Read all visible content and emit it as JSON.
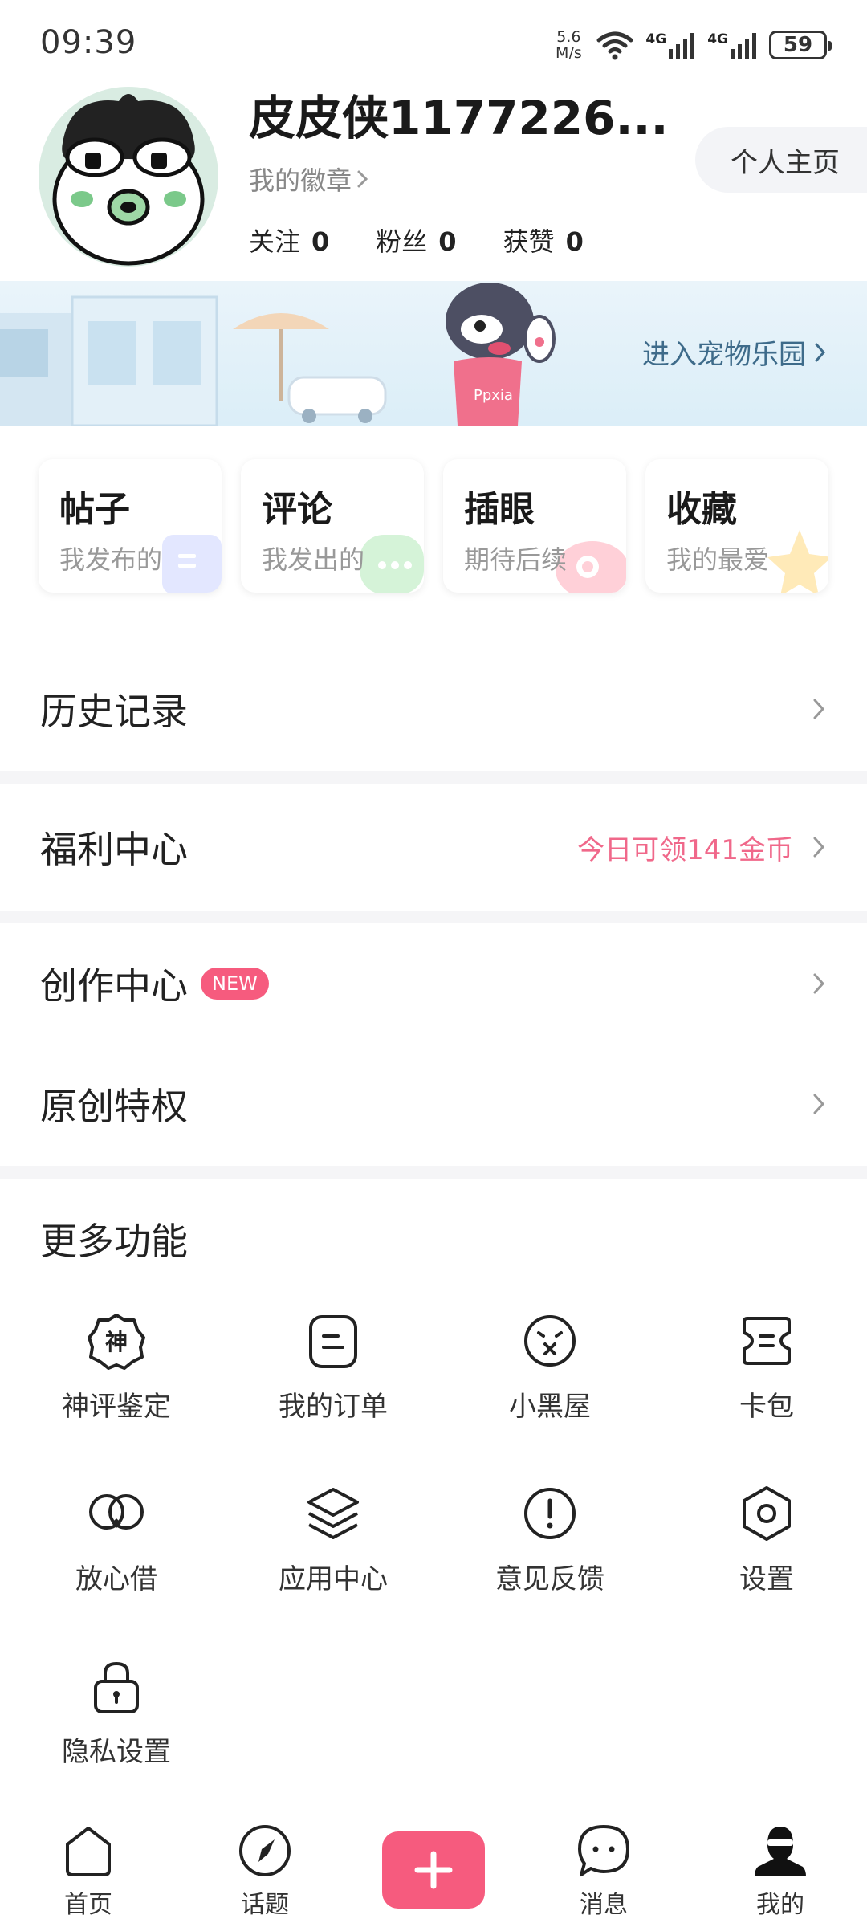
{
  "status_bar": {
    "time": "09:39",
    "speed_value": "5.6",
    "speed_unit": "M/s",
    "network_1": "4G",
    "network_2": "4G",
    "battery": "59"
  },
  "profile": {
    "username": "皮皮侠1177226...",
    "badge_label": "我的徽章",
    "stats": [
      {
        "label": "关注",
        "value": "0"
      },
      {
        "label": "粉丝",
        "value": "0"
      },
      {
        "label": "获赞",
        "value": "0"
      }
    ],
    "homepage_button": "个人主页"
  },
  "banner": {
    "text": "进入宠物乐园",
    "mascot_shirt_text": "Ppxia"
  },
  "cards": [
    {
      "title": "帖子",
      "subtitle": "我发布的",
      "color": "#dfe4ff"
    },
    {
      "title": "评论",
      "subtitle": "我发出的",
      "color": "#d9f5dc"
    },
    {
      "title": "插眼",
      "subtitle": "期待后续",
      "color": "#ffd6dc"
    },
    {
      "title": "收藏",
      "subtitle": "我的最爱",
      "color": "#ffedc2"
    }
  ],
  "menu": {
    "history": "历史记录",
    "welfare": "福利中心",
    "welfare_note": "今日可领141金币",
    "creation": "创作中心",
    "creation_tag": "NEW",
    "original": "原创特权"
  },
  "more": {
    "title": "更多功能",
    "items": [
      {
        "label": "神评鉴定",
        "icon": "shen-badge-icon",
        "glyph": "神"
      },
      {
        "label": "我的订单",
        "icon": "order-icon"
      },
      {
        "label": "小黑屋",
        "icon": "sad-face-icon"
      },
      {
        "label": "卡包",
        "icon": "card-wallet-icon"
      },
      {
        "label": "放心借",
        "icon": "loan-icon"
      },
      {
        "label": "应用中心",
        "icon": "layers-icon"
      },
      {
        "label": "意见反馈",
        "icon": "feedback-icon"
      },
      {
        "label": "设置",
        "icon": "settings-icon"
      },
      {
        "label": "隐私设置",
        "icon": "lock-icon"
      }
    ]
  },
  "bottom_nav": [
    {
      "label": "首页",
      "icon": "home-icon"
    },
    {
      "label": "话题",
      "icon": "compass-icon"
    },
    {
      "label": "",
      "icon": "plus-icon"
    },
    {
      "label": "消息",
      "icon": "message-icon"
    },
    {
      "label": "我的",
      "icon": "profile-icon"
    }
  ],
  "colors": {
    "accent": "#f65b7e",
    "note": "#f0688a",
    "banner_text": "#3e6b8a"
  }
}
